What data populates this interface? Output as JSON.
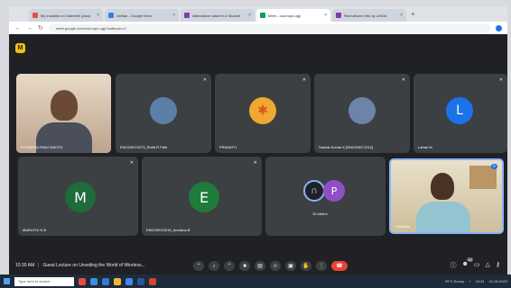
{
  "browser": {
    "tabs": [
      {
        "title": "My installed on Gabrielle (Assl)",
        "color": "#e05252"
      },
      {
        "title": "Delilah - Google Drive",
        "color": "#3b7ddd"
      },
      {
        "title": "Attendance data for a Student",
        "color": "#7b3fa8"
      },
      {
        "title": "Meet - oca-hqrz-ugp",
        "color": "#0f9d58"
      },
      {
        "title": "Recruitment Info by LINDA",
        "color": "#7b3fa8"
      }
    ],
    "new_tab": "+",
    "url": "meet.google.com/oca-hqrz-ugp?authuser=0",
    "back": "←",
    "forward": "→",
    "reload": "↻"
  },
  "meet": {
    "app_badge": "M",
    "meeting_time": "10:30 AM",
    "meeting_title": "Guest Lecture on Unveiling the World of Wireless...",
    "participants_count": "48",
    "tiles": [
      {
        "name": "R.SHEEBA RANI SAKTHI",
        "kind": "video",
        "avatar_color": "#8a6e57"
      },
      {
        "name": "ENG20EC0373_Rohit R Patil",
        "kind": "avatar-img",
        "avatar_color": "#5b7fa6"
      },
      {
        "name": "PRANATH",
        "kind": "avatar-img",
        "avatar_color": "#f0a830"
      },
      {
        "name": "Sakhat Kumar K [ENG20EC1012]",
        "kind": "avatar-img",
        "avatar_color": "#6d84a8"
      },
      {
        "name": "Lahari M",
        "kind": "letter",
        "letter": "L",
        "avatar_color": "#1a73e8"
      },
      {
        "name": "MARUTHI N B",
        "kind": "letter",
        "letter": "M",
        "avatar_color": "#1e6b3b"
      },
      {
        "name": "ENG20EC0015_Archana B",
        "kind": "letter",
        "letter": "E",
        "avatar_color": "#1e7b3b"
      },
      {
        "name": "10 others",
        "kind": "others",
        "letter": "P",
        "avatar_color": "#8e4fc7"
      },
      {
        "name": "Sreekala",
        "kind": "video",
        "avatar_color": "#d6c6a0"
      }
    ]
  },
  "taskbar": {
    "search_placeholder": "Type here to search",
    "weather": "29°C Sunny",
    "time": "10:31",
    "date": "21-04-2023"
  }
}
